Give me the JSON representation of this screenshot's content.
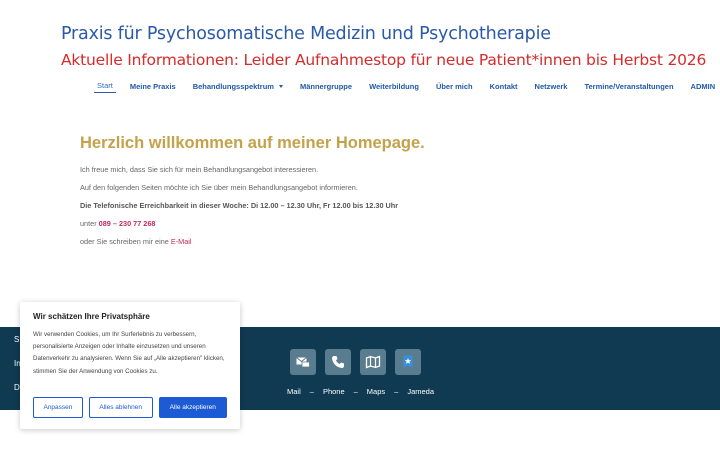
{
  "header": {
    "title": "Praxis für Psychosomatische Medizin und Psychotherapie",
    "notice": "Aktuelle Informationen: Leider Aufnahmestop für neue Patient*innen bis Herbst 2026"
  },
  "nav": {
    "items": [
      {
        "label": "Start"
      },
      {
        "label": "Meine Praxis"
      },
      {
        "label": "Behandlungsspektrum"
      },
      {
        "label": "Männergruppe"
      },
      {
        "label": "Weiterbildung"
      },
      {
        "label": "Über mich"
      },
      {
        "label": "Kontakt"
      },
      {
        "label": "Netzwerk"
      },
      {
        "label": "Termine/Veranstaltungen"
      },
      {
        "label": "ADMIN"
      }
    ],
    "active": "Start"
  },
  "main": {
    "heading": "Herzlich willkommen auf meiner Homepage.",
    "p1": "Ich freue mich, dass Sie sich für mein Behandlungsangebot interessieren.",
    "p2": "Auf den folgenden Seiten möchte ich Sie über mein Behandlungsangebot informieren.",
    "p3": "Die Telefonische Erreichbarkeit in dieser Woche: Di 12.00 – 12.30 Uhr, Fr 12.00 bis 12.30 Uhr",
    "phone_prefix": "unter",
    "phone": "089 – 230 77 268",
    "mail_prefix": "oder Sie schreiben mir eine",
    "mail_link": "E-Mail"
  },
  "footer": {
    "left_items": [
      "S",
      "In",
      "D"
    ],
    "links": {
      "mail": "Mail",
      "phone": "Phone",
      "maps": "Maps",
      "jameda": "Jameda",
      "separator": "–"
    },
    "icons": [
      "mail-icon",
      "phone-icon",
      "map-icon",
      "jameda-icon"
    ]
  },
  "cookie": {
    "title": "Wir schätzen Ihre Privatsphäre",
    "text": "Wir verwenden Cookies, um Ihr Surferlebnis zu verbessern, personalisierte Anzeigen oder Inhalte einzusetzen und unseren Datenverkehr zu analysieren. Wenn Sie auf „Alle akzeptieren\" klicken, stimmen Sie der Anwendung von Cookies zu.",
    "btn_customize": "Anpassen",
    "btn_reject": "Alles ablehnen",
    "btn_accept": "Alle akzeptieren"
  },
  "colors": {
    "title_blue": "#2a5aa8",
    "notice_red": "#d62b2b",
    "heading_gold": "#c4a24a",
    "footer_bg": "#0f3a52",
    "accent_pink": "#c42a5a",
    "button_blue": "#1c5bd3"
  }
}
